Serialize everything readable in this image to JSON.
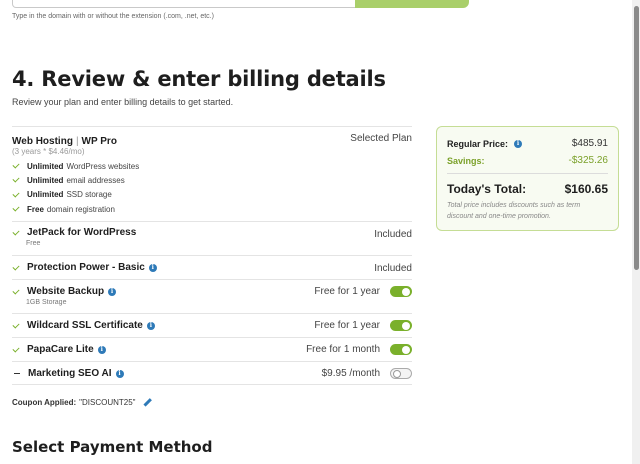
{
  "domain_hint": "Type in the domain with or without the extension (.com, .net, etc.)",
  "section": {
    "title": "4. Review & enter billing details",
    "subtitle": "Review your plan and enter billing details to get started."
  },
  "plan": {
    "name": "Web Hosting",
    "separator": "|",
    "tier": "WP Pro",
    "selected_label": "Selected Plan",
    "price_note": "(3 years * $4.46/mo)",
    "features": [
      {
        "bold": "Unlimited",
        "text": "WordPress websites"
      },
      {
        "bold": "Unlimited",
        "text": "email addresses"
      },
      {
        "bold": "Unlimited",
        "text": "SSD storage"
      },
      {
        "bold": "Free",
        "text": "domain registration"
      }
    ]
  },
  "addons": {
    "jetpack": {
      "title": "JetPack for WordPress",
      "sub": "Free",
      "status": "Included"
    },
    "protection": {
      "title": "Protection Power - Basic",
      "status": "Included"
    },
    "backup": {
      "title": "Website Backup",
      "sub": "1GB Storage",
      "status": "Free for 1 year",
      "enabled": true
    },
    "ssl": {
      "title": "Wildcard SSL Certificate",
      "status": "Free for 1 year",
      "enabled": true
    },
    "papacare": {
      "title": "PapaCare Lite",
      "status": "Free for 1 month",
      "enabled": true
    },
    "seo": {
      "title": "Marketing SEO AI",
      "status": "$9.95 /month",
      "enabled": false
    }
  },
  "coupon": {
    "label": "Coupon Applied:",
    "code": "\"DISCOUNT25\""
  },
  "payment": {
    "title": "Select Payment Method"
  },
  "summary": {
    "regular_label": "Regular Price:",
    "regular_value": "$485.91",
    "savings_label": "Savings:",
    "savings_value": "-$325.26",
    "total_label": "Today's Total:",
    "total_value": "$160.65",
    "note": "Total price includes discounts such as term discount and one-time promotion."
  },
  "colors": {
    "accent_green": "#7ab02b",
    "info_blue": "#2e7ab8",
    "summary_border": "#c5dd95"
  }
}
